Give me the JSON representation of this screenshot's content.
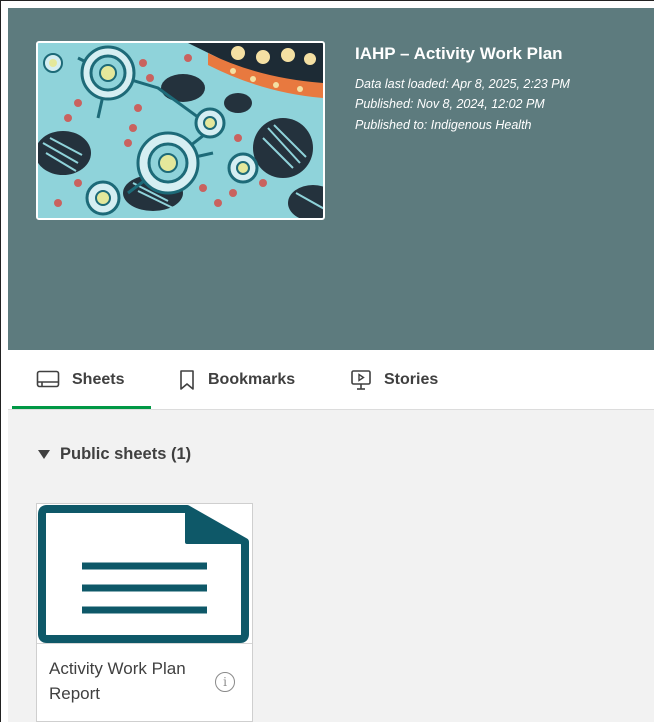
{
  "app": {
    "title": "IAHP – Activity Work Plan",
    "data_last_loaded": "Data last loaded: Apr 8, 2025, 2:23 PM",
    "published": "Published: Nov 8, 2024, 12:02 PM",
    "published_to": "Published to: Indigenous Health",
    "thumbnail_icon": "aboriginal-art-thumbnail"
  },
  "tabs": [
    {
      "label": "Sheets",
      "icon": "sheet-icon",
      "active": true
    },
    {
      "label": "Bookmarks",
      "icon": "bookmark-icon",
      "active": false
    },
    {
      "label": "Stories",
      "icon": "story-icon",
      "active": false
    }
  ],
  "section": {
    "label": "Public sheets (1)"
  },
  "sheets": [
    {
      "title": "Activity Work Plan Report",
      "icon": "document-icon",
      "info_icon": "info-icon"
    }
  ],
  "colors": {
    "header_bg": "#5d7b7e",
    "active_tab": "#009845",
    "doc_icon": "#0e5868",
    "content_bg": "#f2f2f2"
  }
}
